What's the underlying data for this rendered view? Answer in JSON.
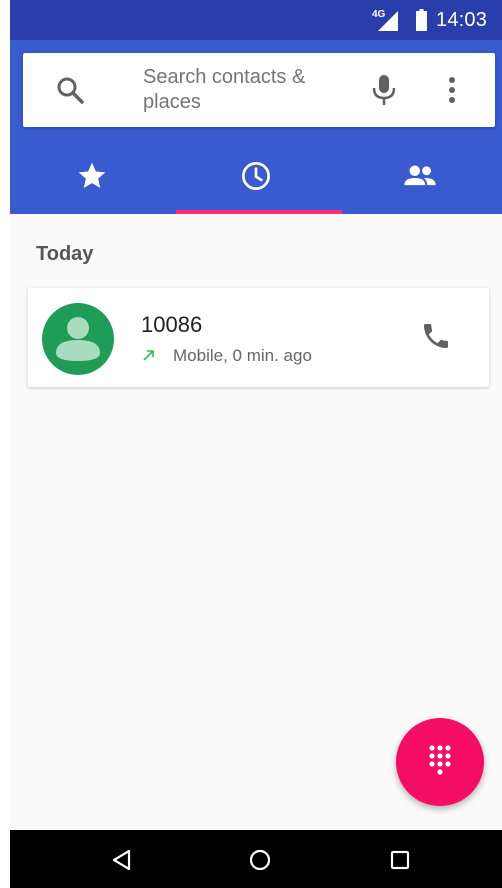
{
  "status_bar": {
    "network": "4G",
    "time": "14:03"
  },
  "search": {
    "placeholder": "Search contacts & places"
  },
  "tabs": [
    {
      "name": "speed-dial",
      "icon": "star-icon",
      "selected": false
    },
    {
      "name": "recents",
      "icon": "clock-icon",
      "selected": true
    },
    {
      "name": "contacts",
      "icon": "people-icon",
      "selected": false
    }
  ],
  "call_log": {
    "section_header": "Today",
    "entries": [
      {
        "number": "10086",
        "detail": "Mobile, 0 min. ago",
        "type": "outgoing",
        "avatar_color": "#1f9d57"
      }
    ]
  },
  "colors": {
    "status_bar": "#2a3eab",
    "app_bar": "#3a5bd0",
    "accent": "#ff2d77",
    "fab": "#f50d63",
    "outgoing_arrow": "#2bbd4e"
  },
  "fab": {
    "icon": "dialpad-icon"
  },
  "nav_bar": {
    "buttons": [
      "back-icon",
      "home-icon",
      "recents-icon"
    ]
  }
}
